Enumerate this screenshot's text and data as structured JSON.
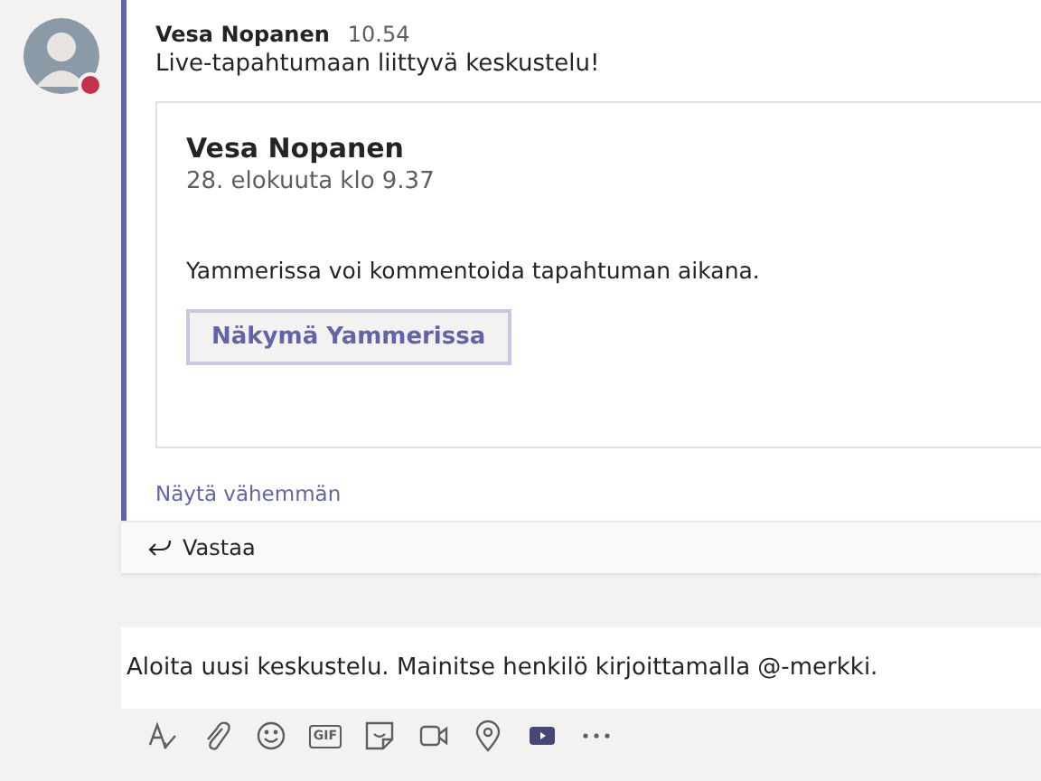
{
  "message": {
    "author": "Vesa Nopanen",
    "time": "10.54",
    "presence": {
      "color": "#c4314b"
    },
    "text": "Live-tapahtumaan liittyvä keskustelu!",
    "card": {
      "title": "Vesa Nopanen",
      "subtitle": "28. elokuuta klo 9.37",
      "body": "Yammerissa voi kommentoida tapahtuman aikana.",
      "button": "Näkymä Yammerissa"
    },
    "collapse_link": "Näytä vähemmän",
    "reply": "Vastaa"
  },
  "compose": {
    "placeholder": "Aloita uusi keskustelu. Mainitse henkilö kirjoittamalla @-merkki."
  },
  "toolbar": [
    {
      "kind": "format"
    },
    {
      "kind": "attach"
    },
    {
      "kind": "emoji"
    },
    {
      "kind": "gif",
      "label": "GIF"
    },
    {
      "kind": "sticker"
    },
    {
      "kind": "meet"
    },
    {
      "kind": "location"
    },
    {
      "kind": "video"
    },
    {
      "kind": "more"
    }
  ]
}
